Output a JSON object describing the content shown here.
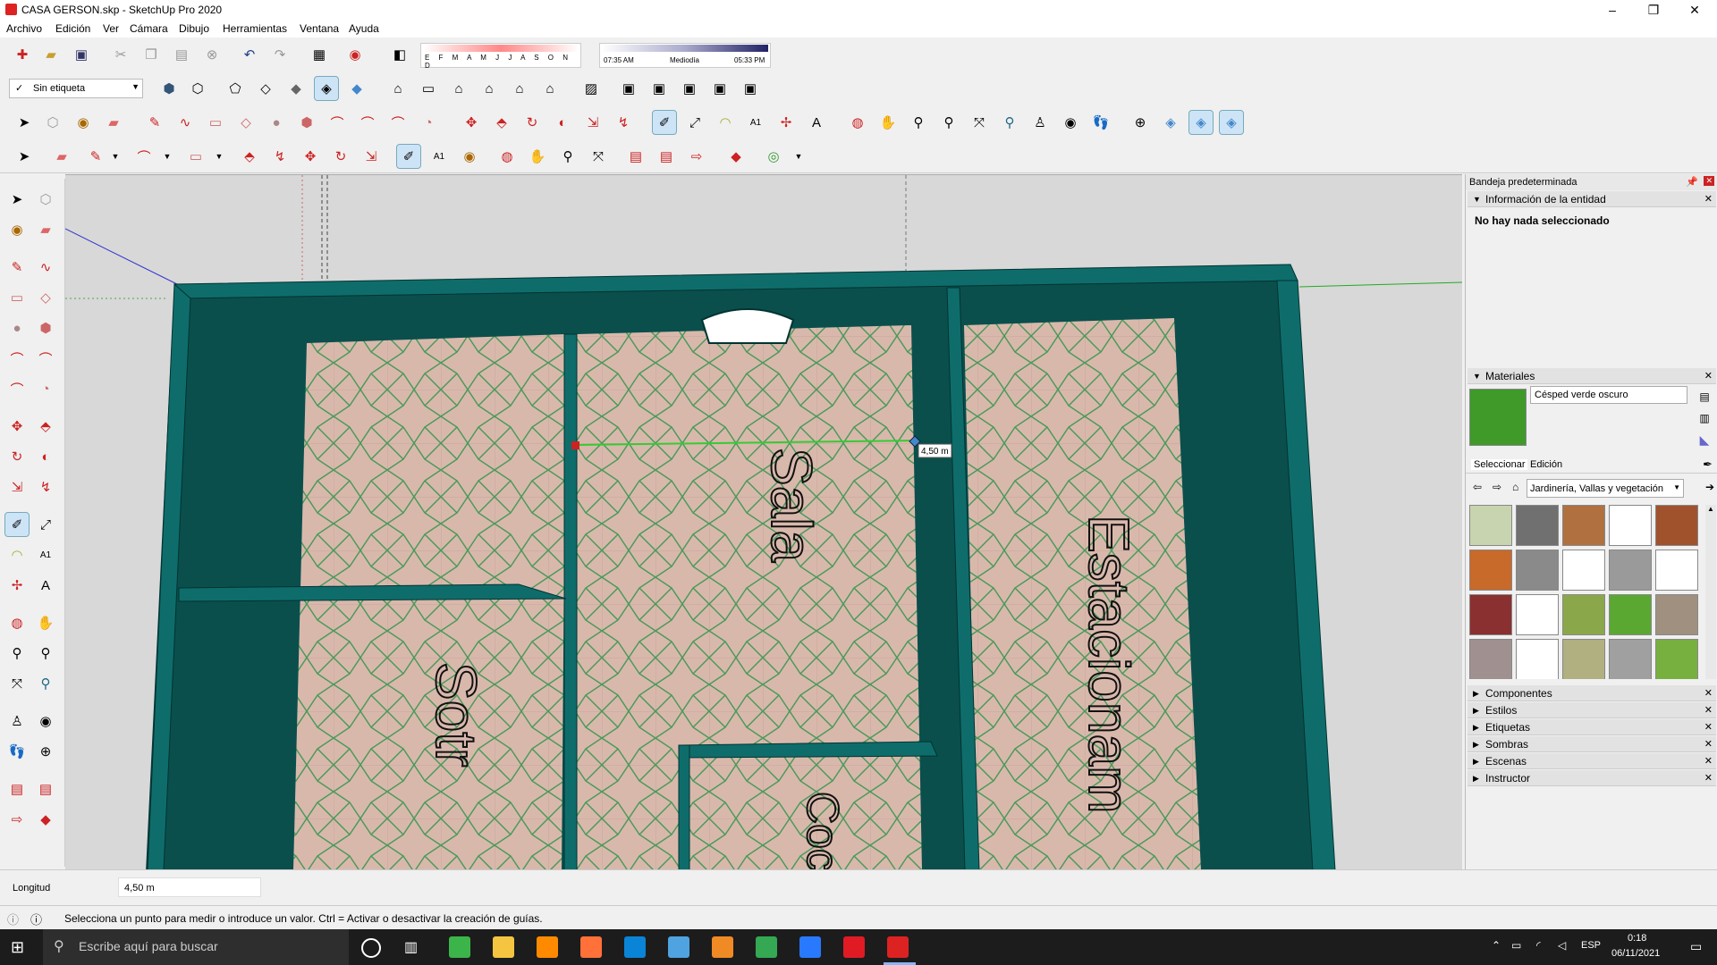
{
  "window": {
    "title": "CASA GERSON.skp - SketchUp Pro 2020",
    "minimize": "–",
    "maximize": "❐",
    "close": "✕"
  },
  "menu": [
    "Archivo",
    "Edición",
    "Ver",
    "Cámara",
    "Dibujo",
    "Herramientas",
    "Ventana",
    "Ayuda"
  ],
  "shadows": {
    "months": "E F M A M J J A S O N D",
    "time_start": "07:35 AM",
    "time_mid": "Mediodía",
    "time_end": "05:33 PM"
  },
  "tag_select": {
    "value": "Sin etiqueta"
  },
  "model": {
    "rooms": [
      "Sala",
      "Estacionam",
      "Sotr",
      "Coc"
    ],
    "measure_tooltip": "4,50 m"
  },
  "tray": {
    "title": "Bandeja predeterminada",
    "entity_info": {
      "header": "Información de la entidad",
      "message": "No hay nada seleccionado"
    },
    "materials": {
      "header": "Materiales",
      "current": "Césped verde oscuro",
      "tabs": [
        "Seleccionar",
        "Edición"
      ],
      "library": "Jardinería, Vallas y vegetación",
      "swatch_colors": [
        "#c8d4b0",
        "#707070",
        "#b07040",
        "#ffffff",
        "#a0522d",
        "#c86a2a",
        "#8a8a8a",
        "#ffffff",
        "#9a9a9a",
        "#ffffff",
        "#8b3030",
        "#ffffff",
        "#8aa84a",
        "#5aa832",
        "#a09080",
        "#a09090",
        "#ffffff",
        "#b0b080",
        "#a0a0a0",
        "#78b040"
      ]
    },
    "panels": [
      "Componentes",
      "Estilos",
      "Etiquetas",
      "Sombras",
      "Escenas",
      "Instructor"
    ]
  },
  "measurements": {
    "label": "Longitud",
    "value": "4,50 m"
  },
  "status": {
    "hint": "Selecciona un punto para medir o introduce un valor. Ctrl = Activar o desactivar la creación de guías."
  },
  "taskbar": {
    "search": "Escribe aquí para buscar",
    "lang": "ESP",
    "time": "0:18",
    "date": "06/11/2021",
    "app_colors": [
      "#3bb54a",
      "#f5c542",
      "#ff8a00",
      "#ff7139",
      "#0a84d6",
      "#4fa3e0",
      "#f08a24",
      "#34a853",
      "#2979ff",
      "#e01b24",
      "#d22"
    ]
  },
  "colors": {
    "wall": "#0e6d6a",
    "wall_dark": "#063a3a",
    "floor": "#d9b8ac",
    "accent": "#d22"
  }
}
